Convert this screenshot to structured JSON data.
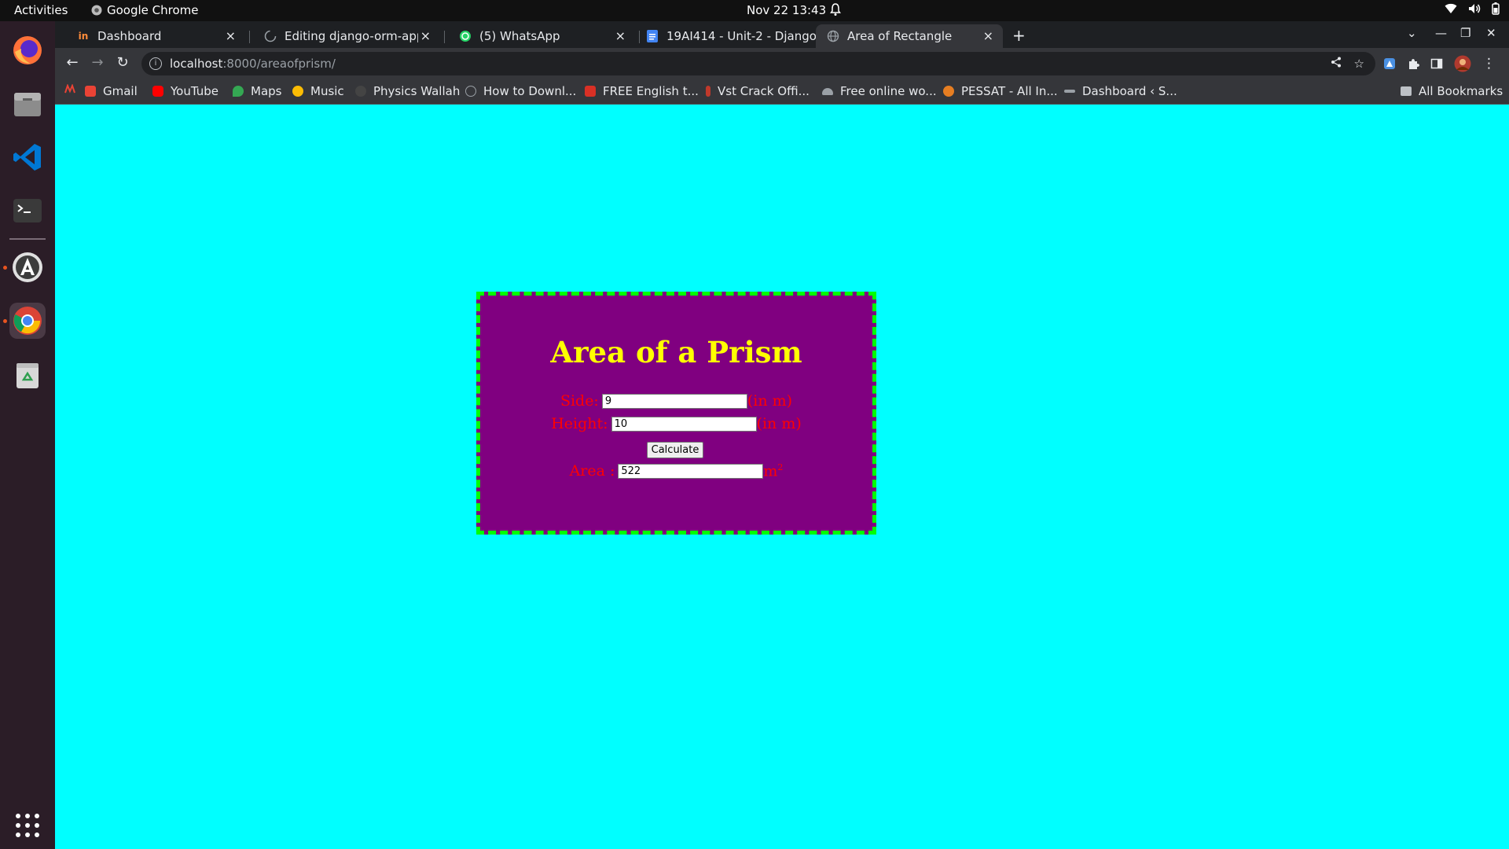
{
  "topbar": {
    "activities": "Activities",
    "app_name": "Google Chrome",
    "clock": "Nov 22  13:43"
  },
  "dock": {
    "items": [
      "firefox-icon",
      "files-icon",
      "vscode-icon",
      "terminal-icon",
      "software-updater-icon",
      "chrome-icon",
      "trash-icon"
    ]
  },
  "tabs": [
    {
      "title": "Dashboard",
      "close": "×"
    },
    {
      "title": "Editing django-orm-app/",
      "close": "×"
    },
    {
      "title": "(5) WhatsApp",
      "close": "×"
    },
    {
      "title": "19AI414 - Unit-2 - Django",
      "close": "×"
    },
    {
      "title": "Area of Rectangle",
      "close": "×"
    }
  ],
  "omnibox": {
    "host": "localhost",
    "path": ":8000/areaofprism/"
  },
  "bookmarks": [
    {
      "label": "Gmail",
      "color": "#ea4335"
    },
    {
      "label": "YouTube",
      "color": "#ff0000"
    },
    {
      "label": "Maps",
      "color": "#34a853"
    },
    {
      "label": "Music",
      "color": "#fbbc04"
    },
    {
      "label": "Physics Wallah",
      "color": "#444444"
    },
    {
      "label": "How to Downl...",
      "color": "#9aa0a6"
    },
    {
      "label": "FREE English t...",
      "color": "#d93025"
    },
    {
      "label": "Vst Crack Offi...",
      "color": "#c0392b"
    },
    {
      "label": "Free online wo...",
      "color": "#9aa0a6"
    },
    {
      "label": "PESSAT - All In...",
      "color": "#e67e22"
    },
    {
      "label": "Dashboard ‹ S...",
      "color": "#9aa0a6"
    }
  ],
  "all_bookmarks": "All Bookmarks",
  "page": {
    "background": "#00ffff",
    "card_background": "#800080",
    "border_color": "#00ff00",
    "title": "Area of a Prism",
    "side_label": "Side:",
    "side_value": "9",
    "side_unit": "(in m)",
    "height_label": "Height:",
    "height_value": "10",
    "height_unit": "(in m)",
    "calculate_label": "Calculate",
    "area_label": "Area :",
    "area_value": "522",
    "area_unit": "m",
    "area_unit_exp": "2"
  }
}
